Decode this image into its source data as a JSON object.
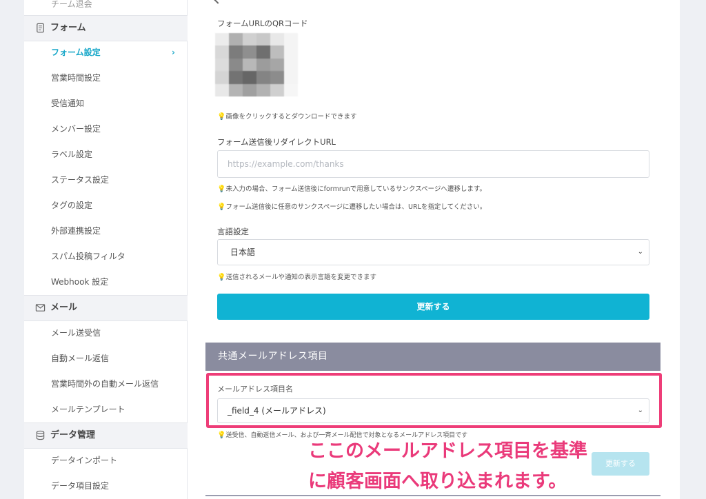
{
  "sidebar": {
    "cut_item": "チーム退会",
    "form_section": "フォーム",
    "form_items": [
      "フォーム設定",
      "営業時間設定",
      "受信通知",
      "メンバー設定",
      "ラベル設定",
      "ステータス設定",
      "タグの設定",
      "外部連携設定",
      "スパム投稿フィルタ",
      "Webhook 設定"
    ],
    "active_chevron": "›",
    "mail_section": "メール",
    "mail_items": [
      "メール送受信",
      "自動メール返信",
      "営業時間外の自動メール返信",
      "メールテンプレート"
    ],
    "data_section": "データ管理",
    "data_items": [
      "データインポート",
      "データ項目設定"
    ]
  },
  "main": {
    "qr_label": "フォームURLのQRコード",
    "qr_hint": "画像をクリックするとダウンロードできます",
    "redirect_label": "フォーム送信後リダイレクトURL",
    "redirect_placeholder": "https://example.com/thanks",
    "redirect_hint1": "未入力の場合、フォーム送信後にformrunで用意しているサンクスページへ遷移します。",
    "redirect_hint2": "フォーム送信後に任意のサンクスページに遷移したい場合は、URLを指定してください。",
    "lang_label": "言語設定",
    "lang_value": "日本語",
    "lang_hint": "送信されるメールや通知の表示言語を変更できます",
    "update_button": "更新する",
    "email_panel_title": "共通メールアドレス項目",
    "email_field_label": "メールアドレス項目名",
    "email_field_value": "_field_4 (メールアドレス)",
    "email_hint": "送受信、自動返信メール、および一斉メール配信で対象となるメールアドレス項目です",
    "update_button2": "更新する"
  },
  "annotation": {
    "line1": "ここのメールアドレス項目を基準",
    "line2": "に顧客画面へ取り込まれます。"
  },
  "icons": {
    "bulb": "💡",
    "chevron": "⌄"
  },
  "colors": {
    "accent": "#10b3d3",
    "highlight": "#ee3d78",
    "panel_header": "#8a8c9f"
  }
}
